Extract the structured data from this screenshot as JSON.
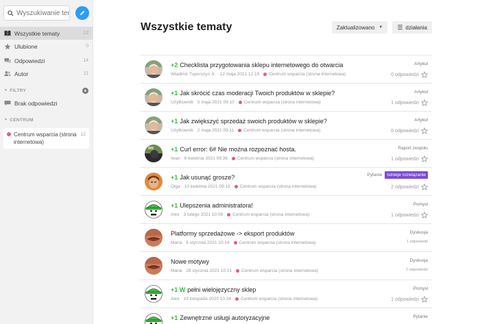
{
  "search": {
    "placeholder": "Wyszukiwanie tematu"
  },
  "sidebar": {
    "items": [
      {
        "label": "Wszystkie tematy",
        "count": "12",
        "icon": "book-icon",
        "active": true
      },
      {
        "label": "Ulubione",
        "count": "0",
        "icon": "star-icon"
      },
      {
        "label": "Odpowiedzi",
        "count": "14",
        "icon": "chat-icon"
      },
      {
        "label": "Autor",
        "count": "11",
        "icon": "users-icon"
      }
    ],
    "filters": {
      "label": "FILTRY",
      "items": [
        {
          "label": "Brak odpowiedzi",
          "icon": "no-reply-icon"
        }
      ]
    },
    "category_section": {
      "label": "CENTRUM",
      "items": [
        {
          "label": "Centrum wsparcia (strona internetowa)",
          "count": "12",
          "color": "#e35c7b"
        }
      ]
    }
  },
  "main": {
    "title": "Wszystkie tematy",
    "sort_label": "Zaktualizowano",
    "actions_label": "działania"
  },
  "topics": [
    {
      "score": "+2",
      "title": "Checklista przygotowania sklepu internetowego do otwarcia",
      "author": "Władimir Tuporszyn Jr.",
      "date": "12 maja 2021 12:19",
      "category": "Centrum wsparcia (strona internetowa)",
      "type": "Artykuł",
      "replies": "0 odpowiedzi",
      "avatar": "photo"
    },
    {
      "score": "+1",
      "title": "Jak skrócić czas moderacji Twoich produktów w sklepie?",
      "author": "Użytkownik",
      "date": "5 maja 2021 09:10",
      "category": "Centrum wsparcia (strona internetowa)",
      "type": "Artykuł",
      "replies": "1 odpowiedzi",
      "avatar": "photo"
    },
    {
      "score": "+1",
      "title": "Jak zwiększyć sprzedaż swoich produktów w sklepie?",
      "author": "Użytkownik",
      "date": "2 maja 2021 09:11",
      "category": "Centrum wsparcia (strona internetowa)",
      "type": "Artykuł",
      "replies": "0 odpowiedzi",
      "avatar": "photo"
    },
    {
      "score": "+1",
      "title": "Curl error: 6# Nie można rozpoznać hosta.",
      "author": "Iwan",
      "date": "6 kwietnia 2021 09:36",
      "category": "Centrum wsparcia (strona internetowa)",
      "type": "Raport zespołu",
      "replies": "1 odpowiedzi",
      "avatar": "dark"
    },
    {
      "score": "+1",
      "title": "Jak usunąć grosze?",
      "author": "Olga",
      "date": "10 kwietnia 2021 09:19",
      "category": "Centrum wsparcia (strona internetowa)",
      "type": "Pytanie",
      "badge": "Istnieje rozwiązanie",
      "replies": "2 odpowiedzi",
      "avatar": "photo-orange"
    },
    {
      "score": "+1",
      "title": "Ulepszenia administratora!",
      "author": "Alex",
      "date": "3 lutego 2021 10:08",
      "category": "Centrum wsparcia (strona internetowa)",
      "type": "Pomysł",
      "replies": "1 odpowiedzi",
      "avatar": "cartoon"
    },
    {
      "score": "",
      "title": "Platformy sprzedażowe -> eksport produktów",
      "author": "Maria",
      "date": "6 stycznia 2021 10:14",
      "category": "Centrum wsparcia (strona internetowa)",
      "type": "Dyskusja",
      "replies": "1 odpowiedź",
      "avatar": "lips",
      "small_replies": true
    },
    {
      "score": "",
      "title": "Nowe motywy",
      "author": "Maria",
      "date": "28 stycznia 2021 10:21",
      "category": "Centrum wsparcia (strona internetowa)",
      "type": "Dyskusja",
      "replies": "2 odpowiedzi",
      "avatar": "lips",
      "small_replies": true
    },
    {
      "score": "+1 W",
      "title": "pełni wielojęzyczny sklep",
      "author": "Alex",
      "date": "19 listopada 2020 10:24",
      "category": "Centrum wsparcia (strona internetowa)",
      "type": "Pomysł",
      "replies": "1 odpowiedzi",
      "avatar": "cartoon"
    },
    {
      "score": "+1",
      "title": "Zewnętrzne usługi autoryzacyjne",
      "author": "Alex",
      "date": "7 kwietnia 2021 10:37",
      "category": "Centrum wsparcia (strona internetowa)",
      "type": "Pytanie",
      "replies": "1 odpowiedzi",
      "avatar": "cartoon"
    }
  ]
}
